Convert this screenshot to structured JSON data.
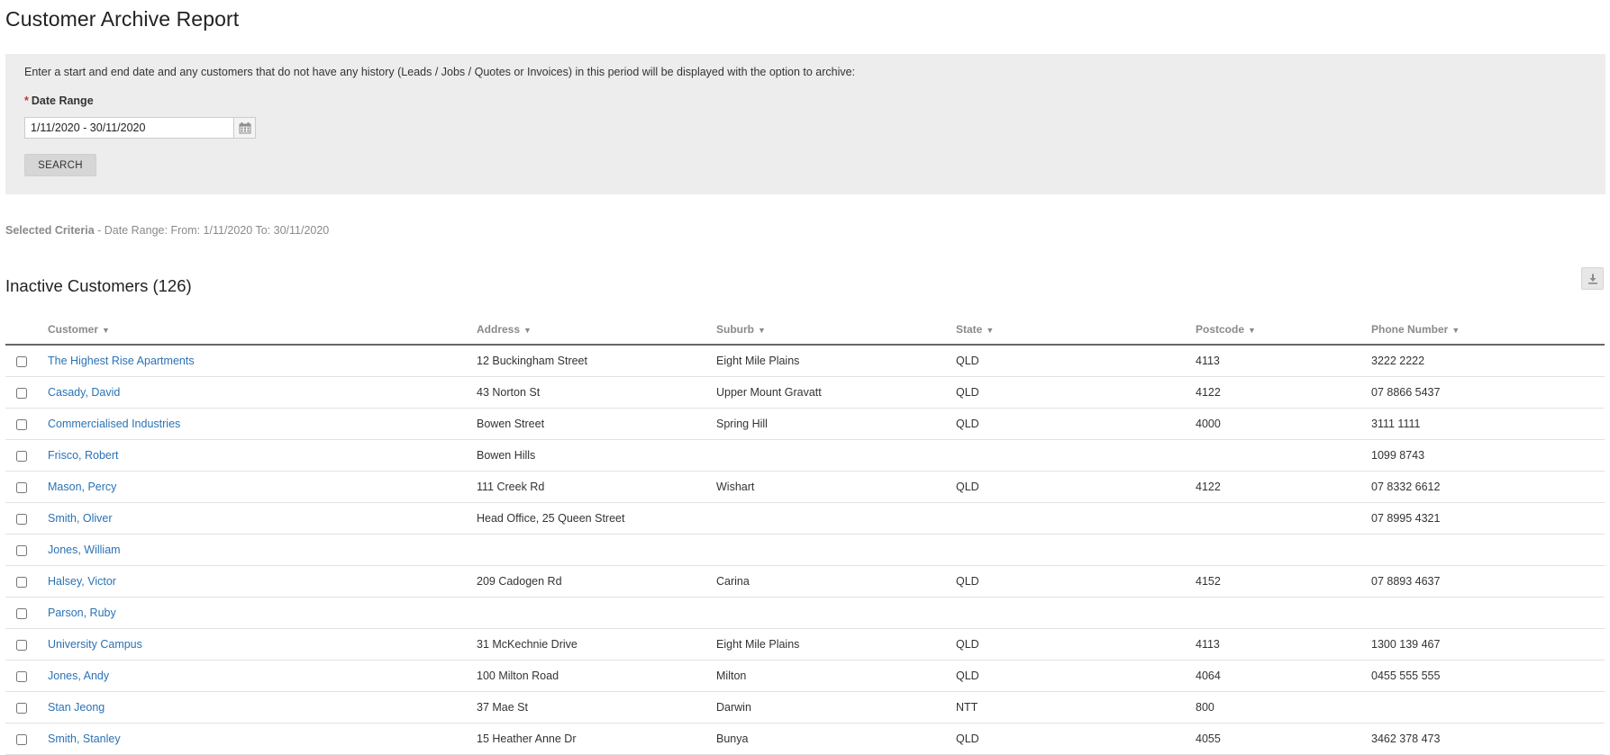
{
  "page": {
    "title": "Customer Archive Report"
  },
  "filter": {
    "instructions": "Enter a start and end date and any customers that do not have any history (Leads / Jobs / Quotes or Invoices) in this period will be displayed with the option to archive:",
    "required_marker": "*",
    "date_range_label": "Date Range",
    "date_range_value": "1/11/2020 - 30/11/2020",
    "calendar_icon": "calendar-icon",
    "search_label": "SEARCH"
  },
  "criteria": {
    "label": "Selected Criteria",
    "text": " - Date Range: From: 1/11/2020 To: 30/11/2020"
  },
  "results": {
    "title": "Inactive Customers (126)",
    "download_icon": "download-icon",
    "sort_arrow": "▼",
    "columns": {
      "customer": "Customer",
      "address": "Address",
      "suburb": "Suburb",
      "state": "State",
      "postcode": "Postcode",
      "phone": "Phone Number"
    },
    "rows": [
      {
        "customer": "The Highest Rise Apartments",
        "address": "12 Buckingham Street",
        "suburb": "Eight Mile Plains",
        "state": "QLD",
        "postcode": "4113",
        "phone": "3222 2222"
      },
      {
        "customer": "Casady, David",
        "address": "43 Norton St",
        "suburb": "Upper Mount Gravatt",
        "state": "QLD",
        "postcode": "4122",
        "phone": "07 8866 5437"
      },
      {
        "customer": "Commercialised Industries",
        "address": "Bowen Street",
        "suburb": "Spring Hill",
        "state": "QLD",
        "postcode": "4000",
        "phone": "3111 1111"
      },
      {
        "customer": "Frisco, Robert",
        "address": "Bowen Hills",
        "suburb": "",
        "state": "",
        "postcode": "",
        "phone": "1099 8743"
      },
      {
        "customer": "Mason, Percy",
        "address": "111 Creek Rd",
        "suburb": "Wishart",
        "state": "QLD",
        "postcode": "4122",
        "phone": "07 8332 6612"
      },
      {
        "customer": "Smith, Oliver",
        "address": "Head Office, 25 Queen Street",
        "suburb": "",
        "state": "",
        "postcode": "",
        "phone": "07 8995 4321"
      },
      {
        "customer": "Jones, William",
        "address": "",
        "suburb": "",
        "state": "",
        "postcode": "",
        "phone": ""
      },
      {
        "customer": "Halsey, Victor",
        "address": "209 Cadogen Rd",
        "suburb": "Carina",
        "state": "QLD",
        "postcode": "4152",
        "phone": "07 8893 4637"
      },
      {
        "customer": "Parson, Ruby",
        "address": "",
        "suburb": "",
        "state": "",
        "postcode": "",
        "phone": ""
      },
      {
        "customer": "University Campus",
        "address": "31 McKechnie Drive",
        "suburb": "Eight Mile Plains",
        "state": "QLD",
        "postcode": "4113",
        "phone": "1300 139 467"
      },
      {
        "customer": "Jones, Andy",
        "address": "100 Milton Road",
        "suburb": "Milton",
        "state": "QLD",
        "postcode": "4064",
        "phone": "0455 555 555"
      },
      {
        "customer": "Stan Jeong",
        "address": "37 Mae St",
        "suburb": "Darwin",
        "state": "NTT",
        "postcode": "800",
        "phone": ""
      },
      {
        "customer": "Smith, Stanley",
        "address": "15 Heather Anne Dr",
        "suburb": "Bunya",
        "state": "QLD",
        "postcode": "4055",
        "phone": "3462 378 473"
      }
    ]
  }
}
